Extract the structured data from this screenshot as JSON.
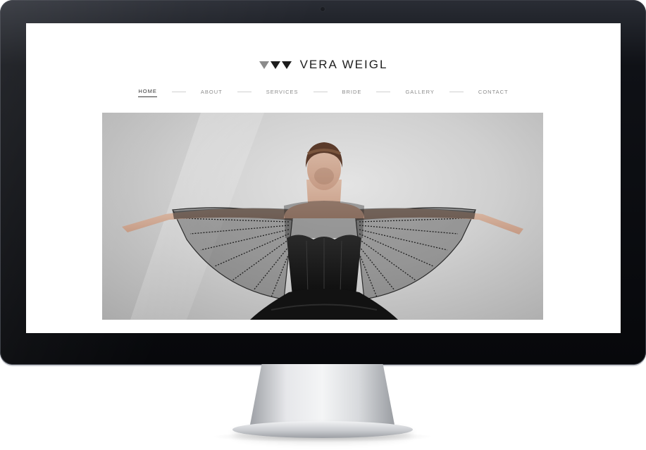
{
  "site": {
    "brand": "VERA WEIGL"
  },
  "nav": {
    "items": [
      {
        "label": "HOME",
        "active": true
      },
      {
        "label": "ABOUT",
        "active": false
      },
      {
        "label": "SERVICES",
        "active": false
      },
      {
        "label": "BRIDE",
        "active": false
      },
      {
        "label": "GALLERY",
        "active": false
      },
      {
        "label": "CONTACT",
        "active": false
      }
    ]
  },
  "colors": {
    "text_dark": "#1e1e1e",
    "nav_inactive": "#8c8c8c",
    "logo_grey_triangle": "#8a8a8a"
  },
  "icons": {
    "logo_mark": "three-triangles-logo",
    "camera": "webcam-dot"
  }
}
